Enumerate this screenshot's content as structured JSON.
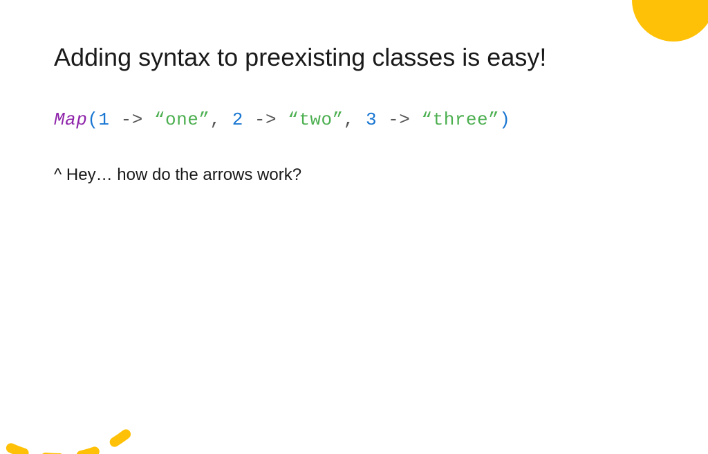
{
  "title": "Adding syntax to preexisting classes is easy!",
  "code": {
    "map": "Map",
    "lparen": "(",
    "n1": "1",
    "arrow1": " -> ",
    "s1": "“one”",
    "c1": ", ",
    "n2": "2",
    "arrow2": " -> ",
    "s2": "“two”",
    "c2": ", ",
    "n3": "3",
    "arrow3": " -> ",
    "s3": "“three”",
    "rparen": ")"
  },
  "question": "^ Hey… how do the arrows work?",
  "colors": {
    "accent": "#FFC107"
  }
}
